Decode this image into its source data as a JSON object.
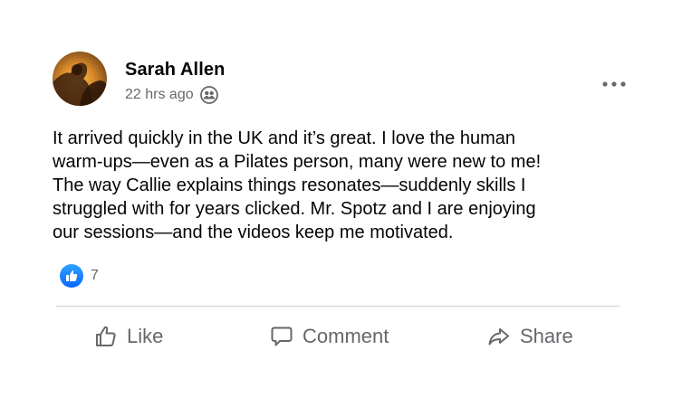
{
  "post": {
    "author": "Sarah Allen",
    "timestamp": "22 hrs ago",
    "audience_icon": "friends-icon",
    "more_icon": "more-options-icon",
    "body_lines": [
      "It arrived quickly in the UK and it’s great. I love the human",
      "warm-ups—even as a Pilates person, many were new to me!",
      "The way Callie explains things resonates—suddenly skills I",
      "struggled with for years clicked. Mr. Spotz and I are enjoying",
      "our sessions—and the videos keep me motivated."
    ],
    "reactions": {
      "icon": "like-reaction-icon",
      "count": "7"
    }
  },
  "actions": {
    "like_label": "Like",
    "comment_label": "Comment",
    "share_label": "Share"
  },
  "colors": {
    "text_primary": "#050505",
    "text_secondary": "#65676b",
    "like_blue": "#0866ff",
    "divider": "#ced0d4"
  }
}
